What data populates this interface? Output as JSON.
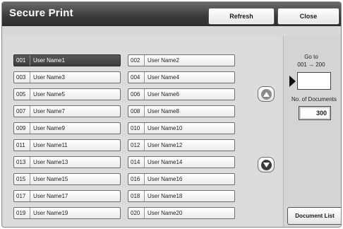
{
  "header": {
    "title": "Secure Print",
    "refresh_label": "Refresh",
    "close_label": "Close"
  },
  "users": [
    {
      "num": "001",
      "name": "User Name1",
      "selected": true
    },
    {
      "num": "002",
      "name": "User Name2"
    },
    {
      "num": "003",
      "name": "User Name3"
    },
    {
      "num": "004",
      "name": "User Name4"
    },
    {
      "num": "005",
      "name": "User Name5"
    },
    {
      "num": "006",
      "name": "User Name6"
    },
    {
      "num": "007",
      "name": "User Name7"
    },
    {
      "num": "008",
      "name": "User Name8"
    },
    {
      "num": "009",
      "name": "User Name9"
    },
    {
      "num": "010",
      "name": "User Name10"
    },
    {
      "num": "011",
      "name": "User Name11"
    },
    {
      "num": "012",
      "name": "User Name12"
    },
    {
      "num": "013",
      "name": "User Name13"
    },
    {
      "num": "014",
      "name": "User Name14"
    },
    {
      "num": "015",
      "name": "User Name15"
    },
    {
      "num": "016",
      "name": "User Name16"
    },
    {
      "num": "017",
      "name": "User Name17"
    },
    {
      "num": "018",
      "name": "User Name18"
    },
    {
      "num": "019",
      "name": "User Name19"
    },
    {
      "num": "020",
      "name": "User Name20"
    }
  ],
  "scroll": {
    "up_icon": "chevron-up-icon",
    "down_icon": "chevron-down-icon"
  },
  "goto": {
    "label_line1": "Go to",
    "label_line2": "001 → 200",
    "value": ""
  },
  "documents": {
    "label": "No. of Documents",
    "count": "300"
  },
  "document_list_label": "Document List",
  "colors": {
    "title_bar": "#3a3a3a",
    "selected_row": "#4a4a4a",
    "panel": "#d8d8d8"
  }
}
